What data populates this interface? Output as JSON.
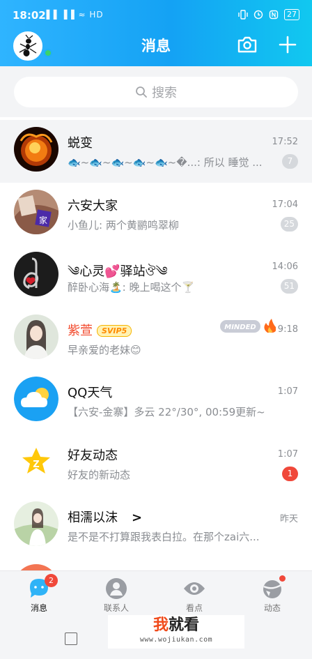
{
  "status_bar": {
    "time": "18:02",
    "signal": "▐▐ ▐▐ ≈ HD",
    "battery": "27"
  },
  "header": {
    "title": "消息"
  },
  "search": {
    "placeholder": "搜索"
  },
  "conversations": [
    {
      "name": "蜕变",
      "message": "🐟~🐟~🐟~🐟~🐟~�...: 所以 睡觉 ...",
      "time": "17:52",
      "badge": "7",
      "pinned": true
    },
    {
      "name": "六安大家",
      "message": "小鱼儿: 两个黄鹂鸣翠柳",
      "time": "17:04",
      "badge": "25"
    },
    {
      "name": "༄心灵💕驿站ঔ༄",
      "message": "醉卧心海🏝️: 晚上喝这个🍸",
      "time": "14:06",
      "badge": "51"
    },
    {
      "name": "紫萱",
      "vip_label": "SVIP5",
      "medal_label": "MINDED",
      "message": "早亲爱的老妹😊",
      "time": "9:18"
    },
    {
      "name": "QQ天气",
      "message": "【六安-金寨】多云 22°/30°, 00:59更新~",
      "time": "1:07"
    },
    {
      "name": "好友动态",
      "message": "好友的新动态",
      "time": "1:07",
      "badge": "1"
    },
    {
      "name": "相濡以沫",
      "arrow": ">",
      "message": "是不是不打算跟我表白拉。在那个zai六...",
      "time": "昨天"
    }
  ],
  "tabs": [
    {
      "label": "消息",
      "badge": "2"
    },
    {
      "label": "联系人"
    },
    {
      "label": "看点"
    },
    {
      "label": "动态"
    }
  ],
  "watermark": {
    "brand_first": "我",
    "brand_rest": "就看",
    "url": "www.wojiukan.com"
  },
  "colors": {
    "header_start": "#2fb4ff",
    "header_end": "#11c8f0",
    "badge_red": "#f0483a",
    "badge_grey": "#d5d8dc"
  }
}
